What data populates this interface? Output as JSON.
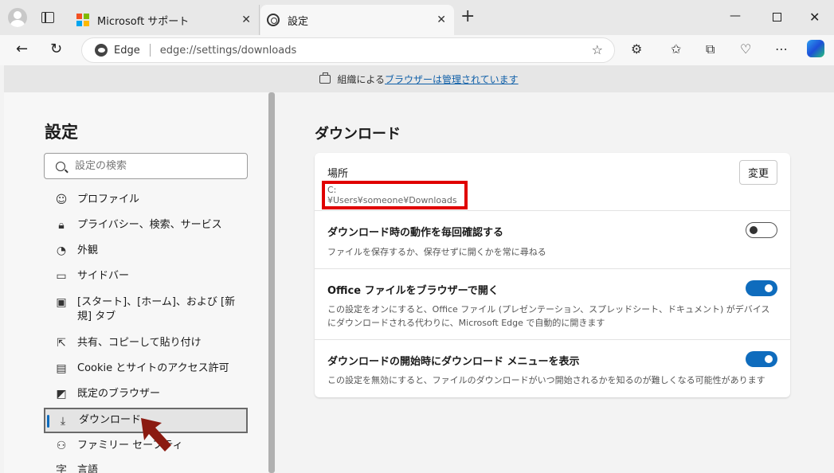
{
  "browser": {
    "tabs": [
      {
        "title": "Microsoft サポート",
        "icon": "microsoft-logo"
      },
      {
        "title": "設定",
        "icon": "gear-icon"
      }
    ],
    "address": {
      "site_label": "Edge",
      "url": "edge://settings/downloads"
    },
    "banner": {
      "prefix": "組織による",
      "link": "ブラウザーは管理されています"
    }
  },
  "sidebar": {
    "title": "設定",
    "search_placeholder": "設定の検索",
    "items": [
      {
        "label": "プロファイル",
        "icon": "profile-icon"
      },
      {
        "label": "プライバシー、検索、サービス",
        "icon": "lock-icon"
      },
      {
        "label": "外観",
        "icon": "palette-icon"
      },
      {
        "label": "サイドバー",
        "icon": "sidebar-icon"
      },
      {
        "label": "[スタート]、[ホーム]、および [新規] タブ",
        "icon": "home-tab-icon"
      },
      {
        "label": "共有、コピーして貼り付け",
        "icon": "share-icon"
      },
      {
        "label": "Cookie とサイトのアクセス許可",
        "icon": "cookie-icon"
      },
      {
        "label": "既定のブラウザー",
        "icon": "browser-icon"
      },
      {
        "label": "ダウンロード",
        "icon": "download-icon"
      },
      {
        "label": "ファミリー セーフティ",
        "icon": "family-icon"
      },
      {
        "label": "言語",
        "icon": "language-icon"
      }
    ],
    "active_index": 8
  },
  "main": {
    "title": "ダウンロード",
    "location": {
      "label": "場所",
      "path": "C:¥Users¥someone¥Downloads",
      "change_button": "変更"
    },
    "settings": [
      {
        "label": "ダウンロード時の動作を毎回確認する",
        "desc": "ファイルを保存するか、保存せずに開くかを常に尋ねる",
        "enabled": false
      },
      {
        "label": "Office ファイルをブラウザーで開く",
        "desc": "この設定をオンにすると、Office ファイル (プレゼンテーション、スプレッドシート、ドキュメント) がデバイスにダウンロードされる代わりに、Microsoft Edge で自動的に開きます",
        "enabled": true
      },
      {
        "label": "ダウンロードの開始時にダウンロード メニューを表示",
        "desc": "この設定を無効にすると、ファイルのダウンロードがいつ開始されるかを知るのが難しくなる可能性があります",
        "enabled": true
      }
    ]
  },
  "colors": {
    "accent": "#0f6cbd",
    "highlight": "#e00000",
    "arrow": "#8b1a10"
  }
}
